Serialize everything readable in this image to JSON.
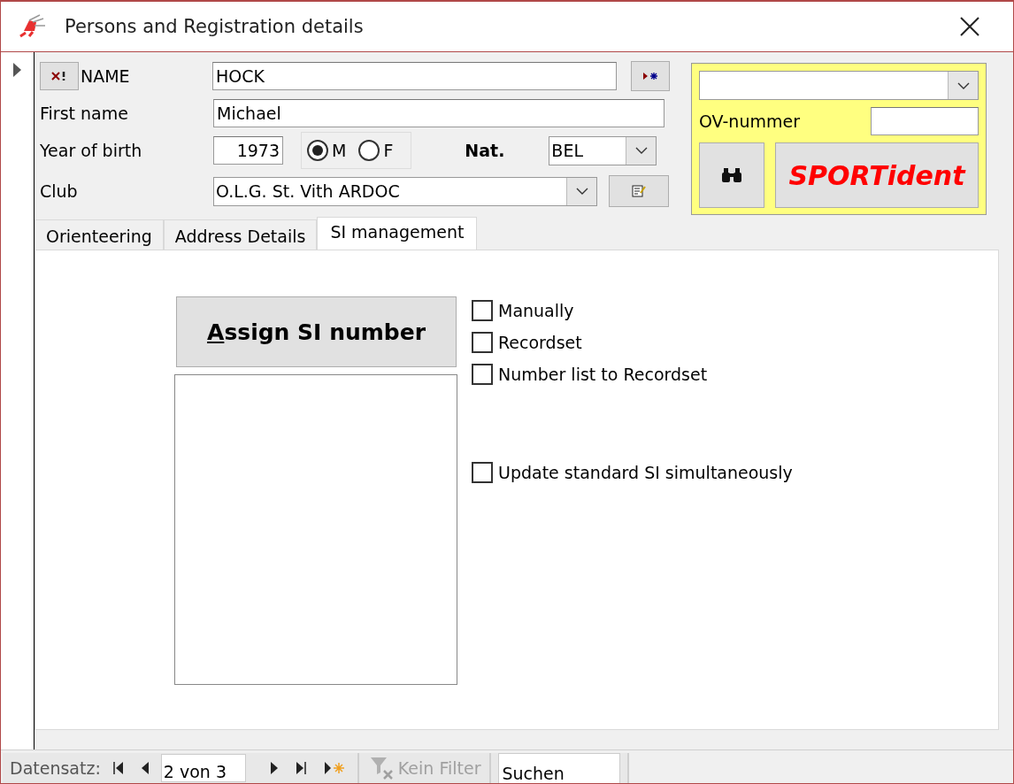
{
  "window": {
    "title": "Persons and Registration details"
  },
  "form": {
    "name_label": "NAME",
    "name_value": "HOCK",
    "first_name_label": "First name",
    "first_name_value": "Michael",
    "year_label": "Year of birth",
    "year_value": "1973",
    "sex_options": [
      {
        "label": "M",
        "selected": true
      },
      {
        "label": "F",
        "selected": false
      }
    ],
    "nat_label": "Nat.",
    "nat_value": "BEL",
    "club_label": "Club",
    "club_value": "O.L.G. St. Vith ARDOC"
  },
  "side_panel": {
    "ov_label": "OV-nummer",
    "sportident_label": "SPORTident"
  },
  "tabs": [
    {
      "label": "Orienteering",
      "selected": false
    },
    {
      "label": "Address Details",
      "selected": false
    },
    {
      "label": "SI management",
      "selected": true
    }
  ],
  "si_management": {
    "assign_button": "Assign SI number",
    "options": [
      {
        "label": "Manually",
        "checked": false
      },
      {
        "label": "Recordset",
        "checked": false
      },
      {
        "label": "Number list to Recordset",
        "checked": false
      },
      {
        "label": "Update standard SI simultaneously",
        "checked": false
      }
    ]
  },
  "status_bar": {
    "record_label": "Datensatz:",
    "record_value": "2 von 3",
    "filter_label": "Kein Filter",
    "search_value": "Suchen"
  }
}
